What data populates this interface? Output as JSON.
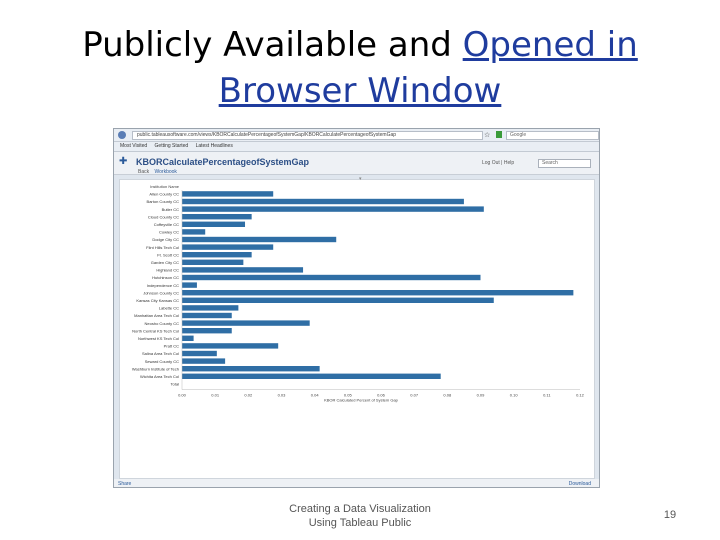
{
  "slide": {
    "title_part1": "Publicly Available and ",
    "title_link1": "Opened in",
    "title_link2": "Browser Window",
    "caption_line1": "Creating a Data Visualization",
    "caption_line2": "Using Tableau Public",
    "page_number": "19"
  },
  "browser": {
    "url": "public.tableausoftware.com/views/KBORCalculatePercentageofSystemGap/KBORCalculatePercentageofSystemGap",
    "search_placeholder": "Google",
    "bookmarks": [
      "Most Visited",
      "Getting Started",
      "Latest Headlines"
    ]
  },
  "tableau": {
    "viz_title": "KBORCalculatePercentageofSystemGap",
    "header_links": "Log Out  |  Help",
    "search_placeholder": "Search",
    "subnav_back": "Back",
    "subnav_workbook": "Workbook",
    "footer_share": "Share",
    "footer_right": "Download"
  },
  "chart_data": {
    "type": "bar",
    "orientation": "horizontal",
    "title": "",
    "header_label": "Institution Name",
    "xlabel": "KBOR Calculated Percent of System Gap",
    "categories": [
      "Allen County CC",
      "Barton County CC",
      "Butler CC",
      "Cloud County CC",
      "Coffeyville CC",
      "Cowley CC",
      "Dodge City CC",
      "Flint Hills Tech Col",
      "Ft. Scott CC",
      "Garden City CC",
      "Highland CC",
      "Hutchinson CC",
      "Independence CC",
      "Johnson County CC",
      "Kansas City Kansas CC",
      "Labette CC",
      "Manhattan Area Tech Col",
      "Neosho County CC",
      "North Central KS Tech Col",
      "Northwest KS Tech Col",
      "Pratt CC",
      "Salina Area Tech Col",
      "Seward County CC",
      "Washburn Institute of Tech",
      "Wichita Area Tech Col",
      "Total"
    ],
    "values": [
      0.0275,
      0.085,
      0.091,
      0.021,
      0.019,
      0.007,
      0.0465,
      0.0275,
      0.021,
      0.0185,
      0.0365,
      0.09,
      0.0045,
      0.118,
      0.094,
      0.017,
      0.015,
      0.0385,
      0.015,
      0.0035,
      0.029,
      0.0105,
      0.013,
      0.0415,
      0.078,
      0
    ],
    "xlim": [
      0,
      0.12
    ],
    "ticks": [
      "0.00",
      "0.01",
      "0.02",
      "0.03",
      "0.04",
      "0.05",
      "0.06",
      "0.07",
      "0.08",
      "0.09",
      "0.10",
      "0.11",
      "0.12"
    ],
    "bar_color": "#2f6ea5",
    "grid": false
  }
}
